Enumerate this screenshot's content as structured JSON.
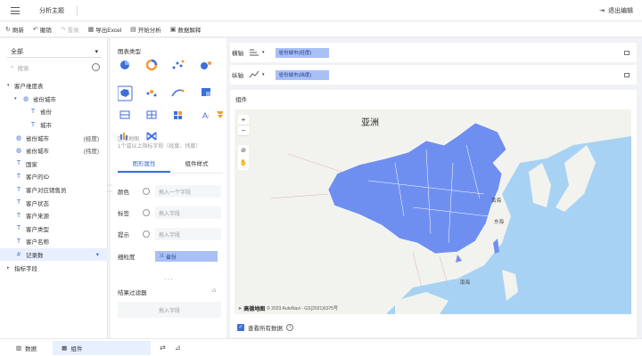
{
  "topbar": {
    "title": "分析主题",
    "exit_label": "退出编辑"
  },
  "toolbar": {
    "items": [
      {
        "label": "刷新",
        "icon": "refresh-icon"
      },
      {
        "label": "撤销",
        "icon": "undo-icon"
      },
      {
        "label": "重做",
        "icon": "redo-icon",
        "disabled": true
      },
      {
        "label": "导出Excel",
        "icon": "excel-icon"
      },
      {
        "label": "开始分析",
        "icon": "analysis-icon"
      },
      {
        "label": "数据解释",
        "icon": "explain-icon"
      }
    ]
  },
  "leftpanel": {
    "select_value": "全部",
    "search_placeholder": "搜索",
    "tree": [
      {
        "label": "客户维度表",
        "level": 0,
        "caret": "▾",
        "icon": ""
      },
      {
        "label": "省份城市",
        "level": 1,
        "caret": "▾",
        "icon": "globe"
      },
      {
        "label": "省份",
        "level": 2,
        "caret": "",
        "icon": "T"
      },
      {
        "label": "城市",
        "level": 2,
        "caret": "",
        "icon": "T"
      },
      {
        "label": "省份城市",
        "level": 0,
        "caret": "",
        "icon": "globe",
        "suffix": "(经度)"
      },
      {
        "label": "省份城市",
        "level": 0,
        "caret": "",
        "icon": "globe",
        "suffix": "(纬度)"
      },
      {
        "label": "国家",
        "level": 0,
        "caret": "",
        "icon": "T"
      },
      {
        "label": "客户的ID",
        "level": 0,
        "caret": "",
        "icon": "T"
      },
      {
        "label": "客户对应销售员",
        "level": 0,
        "caret": "",
        "icon": "T"
      },
      {
        "label": "客户状态",
        "level": 0,
        "caret": "",
        "icon": "T"
      },
      {
        "label": "客户来源",
        "level": 0,
        "caret": "",
        "icon": "T"
      },
      {
        "label": "客户类型",
        "level": 0,
        "caret": "",
        "icon": "T"
      },
      {
        "label": "客户名称",
        "level": 0,
        "caret": "",
        "icon": "T"
      },
      {
        "label": "记录数",
        "level": 0,
        "caret": "",
        "icon": "#",
        "highlight": true
      },
      {
        "label": "指标字段",
        "level": 0,
        "caret": "▸",
        "icon": ""
      }
    ]
  },
  "midpanel": {
    "chart_type_title": "图表类型",
    "hint_line1": "区域地图",
    "hint_line2": "1个或以上指标字段（经度、纬度）",
    "tabs": [
      "图形属性",
      "组件样式"
    ],
    "props": [
      {
        "label": "颜色",
        "value": "拖入一个字段",
        "type": "empty"
      },
      {
        "label": "标签",
        "value": "拖入字段",
        "type": "empty"
      },
      {
        "label": "提示",
        "value": "拖入字段",
        "type": "empty"
      },
      {
        "label": "细粒度",
        "value": "省份",
        "type": "chip"
      }
    ],
    "filter_title": "结果过滤器",
    "filter_placeholder": "拖入字段"
  },
  "axes": {
    "x_label": "横轴",
    "x_chip": "省份城市(经度)",
    "y_label": "纵轴",
    "y_chip": "省份城市(纬度)"
  },
  "map": {
    "title": "组件",
    "continent_label": "亚洲",
    "sea_labels": [
      "黄海",
      "东海",
      "南海"
    ],
    "attribution": "© 2023 AutoNavi - GS(2021)6375号",
    "brand": "高德地图",
    "show_all_label": "查看所有数据",
    "highlight_color": "#6f8ff0",
    "water_color": "#a8d2f4",
    "land_color": "#f2f3ee"
  },
  "bottombar": {
    "data_tab": "数据",
    "component_tab": "组件"
  }
}
